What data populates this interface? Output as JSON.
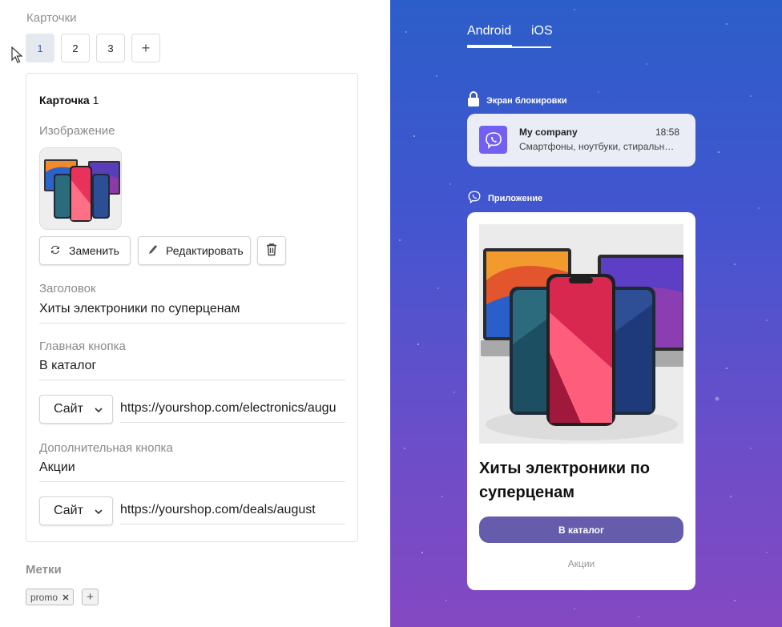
{
  "editor": {
    "cards_title": "Карточки",
    "card_tabs": [
      "1",
      "2",
      "3"
    ],
    "add_tab": "+",
    "card_heading_bold": "Карточка",
    "card_heading_num": "1",
    "image_label": "Изображение",
    "replace_button": "Заменить",
    "edit_button": "Редактировать",
    "title_label": "Заголовок",
    "title_value": "Хиты электроники по суперценам",
    "main_button_label": "Главная кнопка",
    "main_button_value": "В каталог",
    "main_link_type": "Сайт",
    "main_link_url": "https://yourshop.com/electronics/augu",
    "extra_button_label": "Дополнительная кнопка",
    "extra_button_value": "Акции",
    "extra_link_type": "Сайт",
    "extra_link_url": "https://yourshop.com/deals/august",
    "tags_title": "Метки",
    "tags": [
      "promo"
    ],
    "tag_add": "+"
  },
  "preview": {
    "os_tabs": [
      "Android",
      "iOS"
    ],
    "active_os": "Android",
    "lock_section": "Экран блокировки",
    "lock_company": "My company",
    "lock_time": "18:58",
    "lock_text": "Смартфоны, ноутбуки, стиральные машины",
    "app_section": "Приложение",
    "app_title": "Хиты электроники по суперценам",
    "app_button": "В каталог",
    "app_link": "Акции"
  },
  "colors": {
    "brand": "#7360f2",
    "app_button": "#665cac",
    "active_tab_bg": "#e4e8ef",
    "gradient_top": "#2c5ec9",
    "gradient_bottom": "#8448c2"
  },
  "icons": [
    "cursor-arrow-icon",
    "refresh-icon",
    "pencil-icon",
    "trash-icon",
    "chevron-down-icon",
    "lock-icon",
    "viber-icon",
    "close-icon"
  ]
}
